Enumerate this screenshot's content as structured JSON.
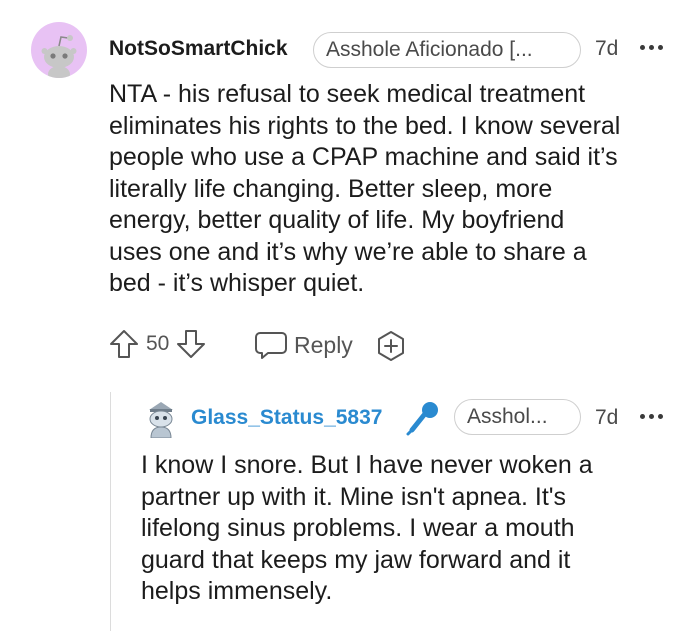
{
  "comment": {
    "username": "NotSoSmartChick",
    "flair": "Asshole Aficionado [...",
    "age": "7d",
    "body_lines": [
      "NTA - his refusal to seek medical treatment",
      "eliminates his rights to the bed. I know several",
      "people who use a CPAP machine and said it’s",
      "literally life changing. Better sleep, more",
      "energy, better quality of life. My boyfriend",
      "uses one and it’s why we’re able to share a",
      "bed - it’s whisper quiet."
    ],
    "vote_count": "50",
    "reply_label": "Reply"
  },
  "reply": {
    "username": "Glass_Status_5837",
    "flair": "Asshol...",
    "age": "7d",
    "body_lines": [
      "I know I snore. But I have never woken a",
      "partner up with it. Mine isn't apnea. It's",
      "lifelong sinus problems. I wear a mouth",
      "guard that keeps my jaw forward and it",
      "helps immensely."
    ]
  },
  "colors": {
    "username_reply": "#2a8ad0",
    "avatar_bg": "#e8c2f4"
  },
  "icons": {
    "upvote": "arrow-up-outline-icon",
    "downvote": "arrow-down-outline-icon",
    "reply": "speech-bubble-icon",
    "award": "plus-hexagon-icon",
    "more": "three-dots-icon",
    "mic": "microphone-icon"
  }
}
